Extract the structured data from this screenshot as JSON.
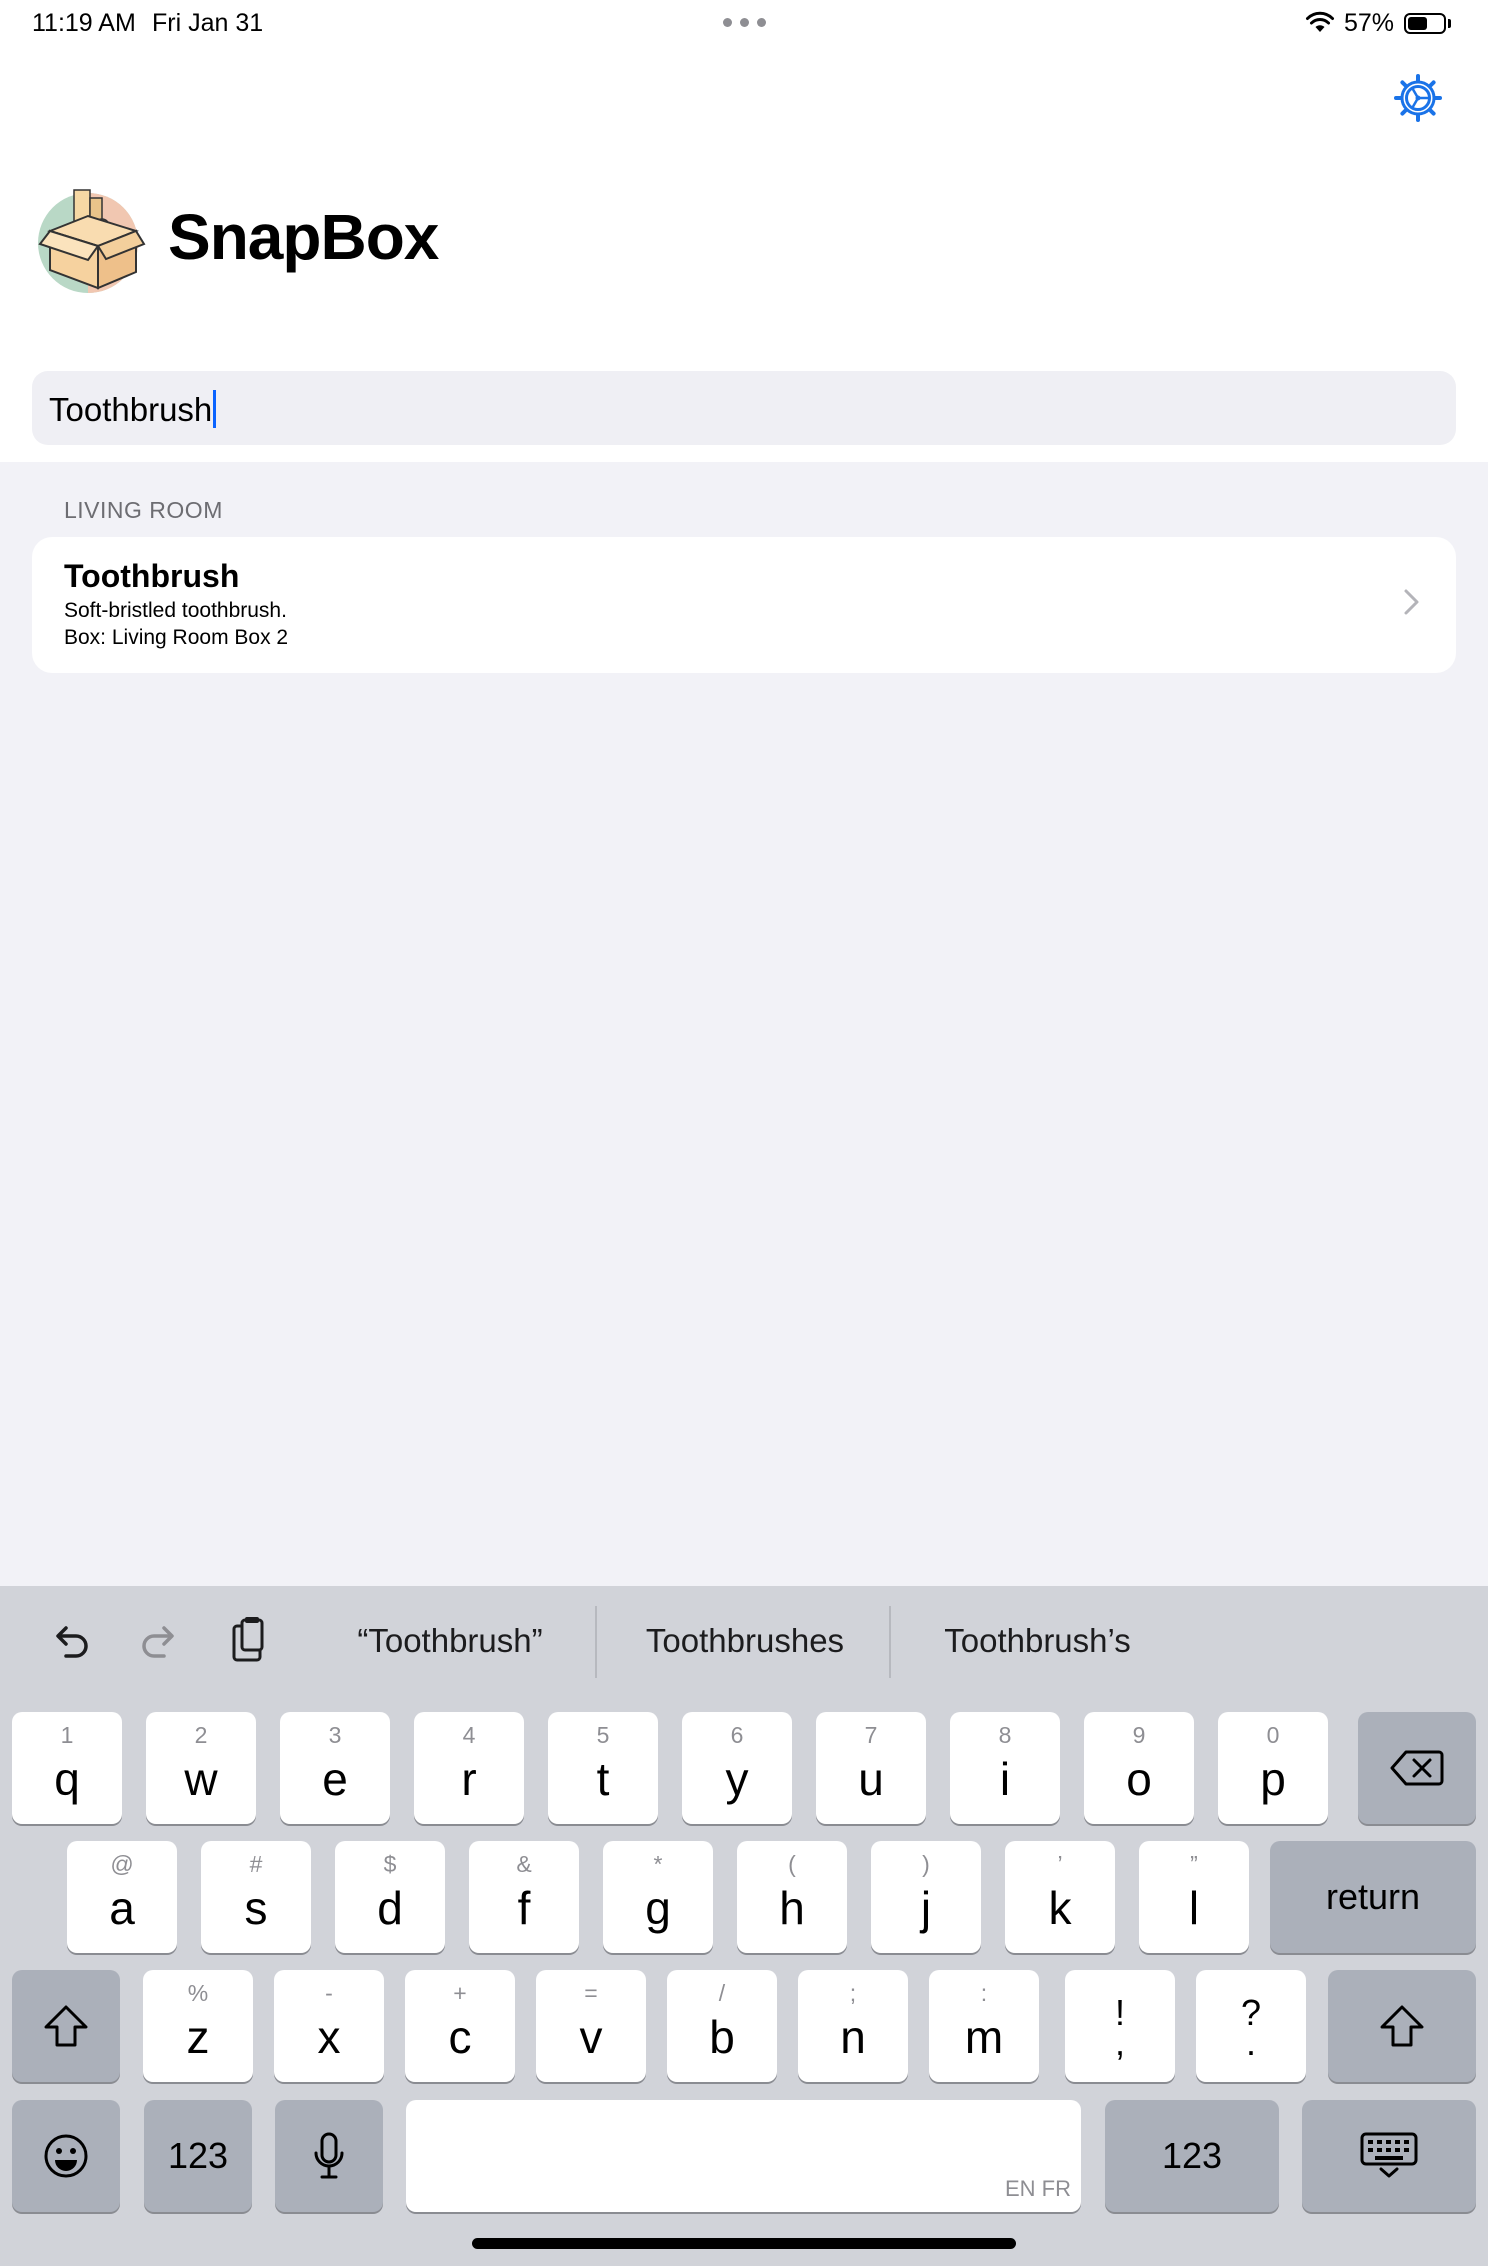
{
  "status_bar": {
    "time": "11:19 AM",
    "date": "Fri Jan 31",
    "battery_percent": "57%",
    "battery_level": 0.57
  },
  "app": {
    "title": "SnapBox",
    "settings_icon": "gear-icon",
    "logo_icon": "box-logo-icon"
  },
  "search": {
    "value": "Toothbrush"
  },
  "results": {
    "section_header": "LIVING ROOM",
    "items": [
      {
        "title": "Toothbrush",
        "description": "Soft-bristled toothbrush.",
        "box": "Box: Living Room Box 2"
      }
    ]
  },
  "keyboard": {
    "suggestions": [
      "“Toothbrush”",
      "Toothbrushes",
      "Toothbrush’s"
    ],
    "row1": [
      {
        "hint": "1",
        "key": "q"
      },
      {
        "hint": "2",
        "key": "w"
      },
      {
        "hint": "3",
        "key": "e"
      },
      {
        "hint": "4",
        "key": "r"
      },
      {
        "hint": "5",
        "key": "t"
      },
      {
        "hint": "6",
        "key": "y"
      },
      {
        "hint": "7",
        "key": "u"
      },
      {
        "hint": "8",
        "key": "i"
      },
      {
        "hint": "9",
        "key": "o"
      },
      {
        "hint": "0",
        "key": "p"
      }
    ],
    "row2": [
      {
        "hint": "@",
        "key": "a"
      },
      {
        "hint": "#",
        "key": "s"
      },
      {
        "hint": "$",
        "key": "d"
      },
      {
        "hint": "&",
        "key": "f"
      },
      {
        "hint": "*",
        "key": "g"
      },
      {
        "hint": "(",
        "key": "h"
      },
      {
        "hint": ")",
        "key": "j"
      },
      {
        "hint": "’",
        "key": "k"
      },
      {
        "hint": "”",
        "key": "l"
      }
    ],
    "row3": [
      {
        "hint": "%",
        "key": "z"
      },
      {
        "hint": "-",
        "key": "x"
      },
      {
        "hint": "+",
        "key": "c"
      },
      {
        "hint": "=",
        "key": "v"
      },
      {
        "hint": "/",
        "key": "b"
      },
      {
        "hint": ";",
        "key": "n"
      },
      {
        "hint": ":",
        "key": "m"
      }
    ],
    "punct1": {
      "top": "!",
      "bottom": ","
    },
    "punct2": {
      "top": "?",
      "bottom": "."
    },
    "return_label": "return",
    "numbers_label": "123",
    "space_lang": "EN FR"
  }
}
